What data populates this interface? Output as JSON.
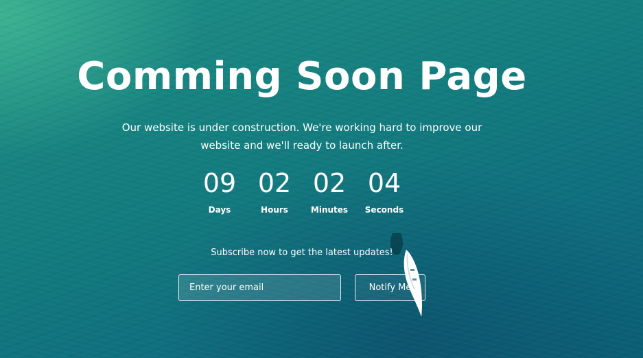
{
  "page": {
    "title": "Comming Soon Page",
    "subtitle": "Our website is under construction. We're working hard to improve our website and we'll ready to launch after.",
    "accent_color": "#15807f"
  },
  "countdown": [
    {
      "value": "09",
      "label": "Days"
    },
    {
      "value": "02",
      "label": "Hours"
    },
    {
      "value": "02",
      "label": "Minutes"
    },
    {
      "value": "04",
      "label": "Seconds"
    }
  ],
  "subscribe": {
    "text": "Subscribe now to get the latest updates!",
    "email_placeholder": "Enter your email",
    "button_label": "Notify Me"
  }
}
